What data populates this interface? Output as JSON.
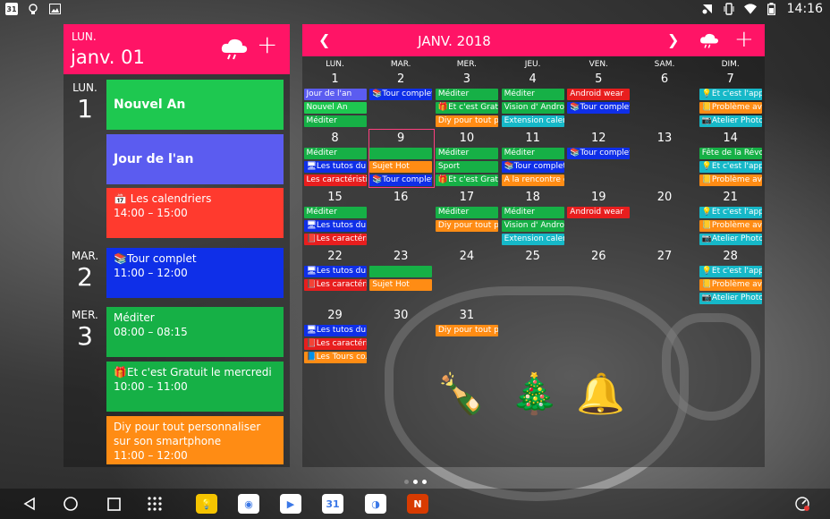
{
  "status": {
    "time": "14:16",
    "calendar_badge": "31"
  },
  "agenda": {
    "header": {
      "day_name": "LUN.",
      "date": "janv. 01"
    },
    "days": [
      {
        "name": "LUN.",
        "num": "1"
      },
      {
        "name": "MAR.",
        "num": "2"
      },
      {
        "name": "MER.",
        "num": "3"
      }
    ],
    "events": [
      {
        "title": "Nouvel An",
        "time": "",
        "color": "#1ec850"
      },
      {
        "title": "Jour de l'an",
        "time": "",
        "color": "#5b5cf0"
      },
      {
        "title": "📅 Les calendriers",
        "time": "14:00 – 15:00",
        "color": "#ff3a2e"
      },
      {
        "title": "📚Tour complet",
        "time": "11:00 – 12:00",
        "color": "#0f2fe8"
      },
      {
        "title": "Méditer",
        "time": "08:00 – 08:15",
        "color": "#16b046"
      },
      {
        "title": "🎁Et c'est Gratuit le mercredi",
        "time": "10:00 – 11:00",
        "color": "#16b046"
      },
      {
        "title": "Diy pour tout personnaliser sur son smartphone",
        "time": "11:00 – 12:00",
        "color": "#ff8c14"
      }
    ]
  },
  "calendar": {
    "month_title": "JANV. 2018",
    "weekdays": [
      "LUN.",
      "MAR.",
      "MER.",
      "JEU.",
      "VEN.",
      "SAM.",
      "DIM."
    ],
    "weeks": [
      [
        "1",
        "2",
        "3",
        "4",
        "5",
        "6",
        "7"
      ],
      [
        "8",
        "9",
        "10",
        "11",
        "12",
        "13",
        "14"
      ],
      [
        "15",
        "16",
        "17",
        "18",
        "19",
        "20",
        "21"
      ],
      [
        "22",
        "23",
        "24",
        "25",
        "26",
        "27",
        "28"
      ],
      [
        "29",
        "30",
        "31",
        "",
        "",
        "",
        ""
      ]
    ],
    "events": [
      {
        "w": 0,
        "d": 0,
        "s": 0,
        "t": "Jour de l'an",
        "c": "#5b5cf0"
      },
      {
        "w": 0,
        "d": 0,
        "s": 1,
        "t": "Nouvel An",
        "c": "#1ec850"
      },
      {
        "w": 0,
        "d": 0,
        "s": 2,
        "t": "Méditer",
        "c": "#16b046"
      },
      {
        "w": 0,
        "d": 1,
        "s": 0,
        "t": "📚Tour complet",
        "c": "#0f2fe8"
      },
      {
        "w": 0,
        "d": 2,
        "s": 0,
        "t": "Méditer",
        "c": "#16b046"
      },
      {
        "w": 0,
        "d": 2,
        "s": 1,
        "t": "🎁Et c'est Gratuit",
        "c": "#16b046"
      },
      {
        "w": 0,
        "d": 2,
        "s": 2,
        "t": "Diy pour tout per..",
        "c": "#ff8c14"
      },
      {
        "w": 0,
        "d": 3,
        "s": 0,
        "t": "Méditer",
        "c": "#16b046"
      },
      {
        "w": 0,
        "d": 3,
        "s": 1,
        "t": "Vision d' Android",
        "c": "#16b046"
      },
      {
        "w": 0,
        "d": 3,
        "s": 2,
        "t": "Extension calend..",
        "c": "#16b8c8"
      },
      {
        "w": 0,
        "d": 4,
        "s": 0,
        "t": "Android wear",
        "c": "#e81e1e"
      },
      {
        "w": 0,
        "d": 4,
        "s": 1,
        "t": "📚Tour complet",
        "c": "#0f2fe8"
      },
      {
        "w": 0,
        "d": 6,
        "s": 0,
        "t": "💡Et c'est l'appli..",
        "c": "#16b8c8"
      },
      {
        "w": 0,
        "d": 6,
        "s": 1,
        "t": "📒Problème av..",
        "c": "#ff8c14"
      },
      {
        "w": 0,
        "d": 6,
        "s": 2,
        "t": "📷Atelier Photos",
        "c": "#16b8c8"
      },
      {
        "w": 1,
        "d": 0,
        "s": 0,
        "t": "Méditer",
        "c": "#16b046"
      },
      {
        "w": 1,
        "d": 0,
        "s": 1,
        "t": "🖥Les tutos du l..",
        "c": "#0f2fe8"
      },
      {
        "w": 1,
        "d": 0,
        "s": 2,
        "t": "Les caractéristiq..",
        "c": "#e81e1e"
      },
      {
        "w": 1,
        "d": 1,
        "s": 0,
        "t": "",
        "c": "#16b046"
      },
      {
        "w": 1,
        "d": 1,
        "s": 1,
        "t": "Sujet Hot",
        "c": "#ff8c14"
      },
      {
        "w": 1,
        "d": 1,
        "s": 2,
        "t": "📚Tour complet",
        "c": "#0f2fe8"
      },
      {
        "w": 1,
        "d": 2,
        "s": 0,
        "t": "Méditer",
        "c": "#16b046"
      },
      {
        "w": 1,
        "d": 2,
        "s": 1,
        "t": "Sport",
        "c": "#16b046"
      },
      {
        "w": 1,
        "d": 2,
        "s": 2,
        "t": "🎁Et c'est Gratuit..",
        "c": "#16b046"
      },
      {
        "w": 1,
        "d": 3,
        "s": 0,
        "t": "Méditer",
        "c": "#16b046"
      },
      {
        "w": 1,
        "d": 3,
        "s": 1,
        "t": "📚Tour complet",
        "c": "#0f2fe8"
      },
      {
        "w": 1,
        "d": 3,
        "s": 2,
        "t": "A la rencontre d'..",
        "c": "#ff8c14"
      },
      {
        "w": 1,
        "d": 4,
        "s": 0,
        "t": "📚Tour complet",
        "c": "#0f2fe8"
      },
      {
        "w": 1,
        "d": 6,
        "s": 0,
        "t": "Fête de la Révolu..",
        "c": "#16b046"
      },
      {
        "w": 1,
        "d": 6,
        "s": 1,
        "t": "💡Et c'est l'appli..",
        "c": "#16b8c8"
      },
      {
        "w": 1,
        "d": 6,
        "s": 2,
        "t": "📒Problème av..",
        "c": "#ff8c14"
      },
      {
        "w": 2,
        "d": 0,
        "s": 0,
        "t": "Méditer",
        "c": "#16b046"
      },
      {
        "w": 2,
        "d": 0,
        "s": 1,
        "t": "🖥Les tutos du l..",
        "c": "#0f2fe8"
      },
      {
        "w": 2,
        "d": 0,
        "s": 2,
        "t": "📕Les caractéri..",
        "c": "#e81e1e"
      },
      {
        "w": 2,
        "d": 2,
        "s": 0,
        "t": "Méditer",
        "c": "#16b046"
      },
      {
        "w": 2,
        "d": 2,
        "s": 1,
        "t": "Diy pour tout per..",
        "c": "#ff8c14"
      },
      {
        "w": 2,
        "d": 3,
        "s": 0,
        "t": "Méditer",
        "c": "#16b046"
      },
      {
        "w": 2,
        "d": 3,
        "s": 1,
        "t": "Vision d' Android",
        "c": "#16b046"
      },
      {
        "w": 2,
        "d": 3,
        "s": 2,
        "t": "Extension calend..",
        "c": "#16b8c8"
      },
      {
        "w": 2,
        "d": 4,
        "s": 0,
        "t": "Android wear",
        "c": "#e81e1e"
      },
      {
        "w": 2,
        "d": 6,
        "s": 0,
        "t": "💡Et c'est l'appli..",
        "c": "#16b8c8"
      },
      {
        "w": 2,
        "d": 6,
        "s": 1,
        "t": "📒Problème av..",
        "c": "#ff8c14"
      },
      {
        "w": 2,
        "d": 6,
        "s": 2,
        "t": "📷Atelier Photos",
        "c": "#16b8c8"
      },
      {
        "w": 3,
        "d": 0,
        "s": 0,
        "t": "🖥Les tutos du l..",
        "c": "#0f2fe8"
      },
      {
        "w": 3,
        "d": 0,
        "s": 1,
        "t": "📕Les caractéri..",
        "c": "#e81e1e"
      },
      {
        "w": 3,
        "d": 1,
        "s": 0,
        "t": "",
        "c": "#16b046"
      },
      {
        "w": 3,
        "d": 1,
        "s": 1,
        "t": "Sujet Hot",
        "c": "#ff8c14"
      },
      {
        "w": 3,
        "d": 6,
        "s": 0,
        "t": "💡Et c'est l'appli..",
        "c": "#16b8c8"
      },
      {
        "w": 3,
        "d": 6,
        "s": 1,
        "t": "📒Problème av..",
        "c": "#ff8c14"
      },
      {
        "w": 3,
        "d": 6,
        "s": 2,
        "t": "📷Atelier Photos",
        "c": "#16b8c8"
      },
      {
        "w": 4,
        "d": 0,
        "s": 0,
        "t": "🖥Les tutos du l..",
        "c": "#0f2fe8"
      },
      {
        "w": 4,
        "d": 0,
        "s": 1,
        "t": "📕Les caractéri..",
        "c": "#e81e1e"
      },
      {
        "w": 4,
        "d": 0,
        "s": 2,
        "t": "📘Les Tours co..",
        "c": "#ff8c14"
      },
      {
        "w": 4,
        "d": 2,
        "s": 0,
        "t": "Diy pour tout per..",
        "c": "#ff8c14"
      }
    ],
    "decorations": [
      "🍾",
      "🎄",
      "🔔"
    ]
  },
  "dock": {
    "apps": [
      {
        "name": "keep",
        "glyph": "💡",
        "color": "#f5c400"
      },
      {
        "name": "chrome",
        "glyph": "◉",
        "color": "#ffffff"
      },
      {
        "name": "play-store",
        "glyph": "▶",
        "color": "#ffffff"
      },
      {
        "name": "calendar",
        "glyph": "31",
        "color": "#ffffff"
      },
      {
        "name": "photos",
        "glyph": "◑",
        "color": "#ffffff"
      },
      {
        "name": "office",
        "glyph": "N",
        "color": "#d83b01"
      }
    ]
  }
}
